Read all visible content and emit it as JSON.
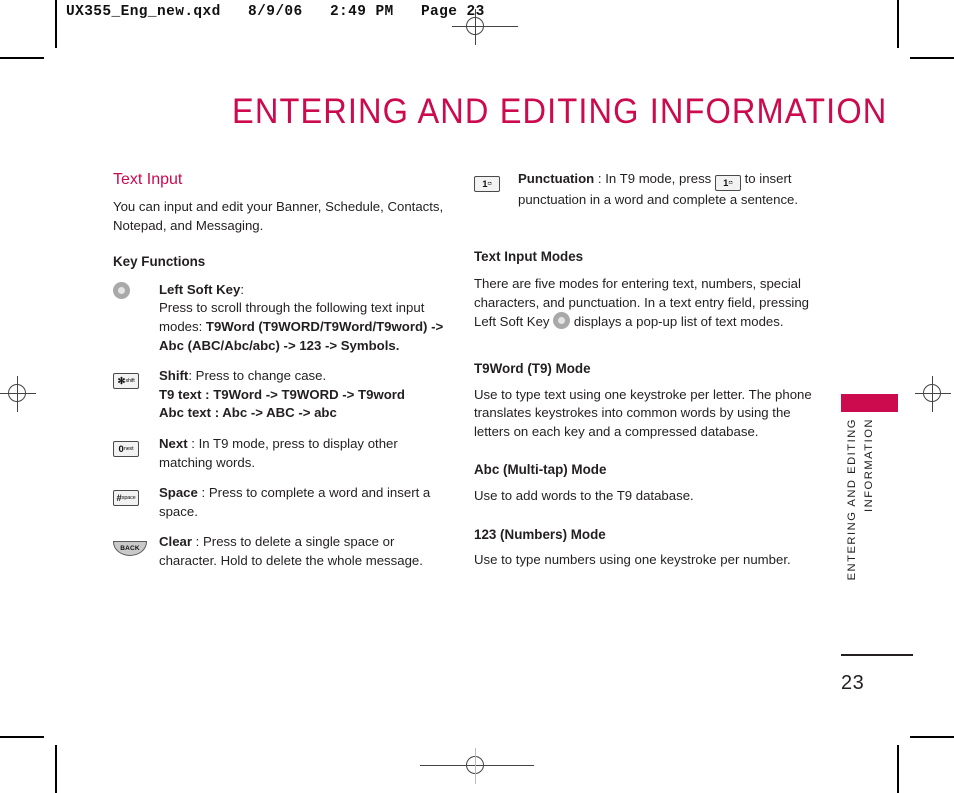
{
  "prepress": {
    "header": "UX355_Eng_new.qxd   8/9/06   2:49 PM   Page 23"
  },
  "title": "ENTERING AND EDITING INFORMATION",
  "left_column": {
    "section_title": "Text Input",
    "intro": "You can input and edit your Banner, Schedule, Contacts, Notepad, and Messaging.",
    "key_functions_heading": "Key Functions",
    "key_functions": [
      {
        "icon": "soft-key-icon",
        "icon_label": "",
        "term": "Left Soft Key",
        "separator": ":",
        "description": "Press to scroll through the following text input modes:",
        "bold_tail": "T9Word (T9WORD/T9Word/T9word) -> Abc (ABC/Abc/abc) -> 123 -> Symbols."
      },
      {
        "icon": "star-key-icon",
        "icon_big": "✻",
        "icon_sub": "shift",
        "term": "Shift",
        "separator": ":",
        "description": "Press to change case.",
        "bold_line_1": "T9 text : T9Word -> T9WORD -> T9word",
        "bold_line_2": "Abc text : Abc -> ABC -> abc"
      },
      {
        "icon": "zero-next-key-icon",
        "icon_big": "0",
        "icon_sub": "next",
        "term": "Next",
        "separator": ":",
        "description": "In T9 mode, press to display other matching words."
      },
      {
        "icon": "pound-space-key-icon",
        "icon_big": "#",
        "icon_sub": "space",
        "term": "Space",
        "separator": ":",
        "description": "Press to complete a word and insert a space."
      },
      {
        "icon": "back-key-icon",
        "icon_label": "BACK",
        "term": "Clear",
        "separator": ":",
        "description": "Press to delete a single space or character. Hold to delete the whole message."
      }
    ]
  },
  "right_column": {
    "punctuation_item": {
      "icon": "one-punctuation-key-icon",
      "icon_big": "1",
      "icon_sub": "ඏ",
      "term": "Punctuation",
      "separator": ":",
      "text_before": "In T9 mode, press",
      "text_after": "to insert punctuation in a word and complete a sentence."
    },
    "text_input_modes_heading": "Text Input Modes",
    "text_input_modes_para_before": "There are five modes for entering text, numbers, special characters, and punctuation. In a text entry field, pressing  Left Soft Key",
    "text_input_modes_para_after": "displays a pop-up list of text modes.",
    "modes": [
      {
        "heading": "T9Word (T9) Mode",
        "body": "Use to type text using one keystroke per letter. The phone translates keystrokes into common words by using the letters on each key and a compressed database."
      },
      {
        "heading": "Abc (Multi-tap) Mode",
        "body": "Use to add words to the T9 database."
      },
      {
        "heading": "123 (Numbers) Mode",
        "body": "Use to type numbers using one keystroke per number."
      }
    ]
  },
  "thumb_tab": {
    "line_1": "ENTERING AND EDITING",
    "line_2": "INFORMATION"
  },
  "folio": {
    "page_number": "23"
  },
  "colors": {
    "accent": "#CC0A4E",
    "text": "#231f20"
  }
}
